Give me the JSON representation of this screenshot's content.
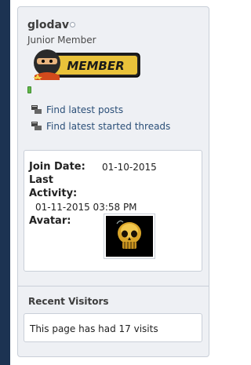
{
  "profile": {
    "username": "glodav",
    "user_title": "Junior Member",
    "rank_badge_text": "MEMBER",
    "online_status_icon": "offline-dot-icon",
    "reputation_color": "#61b74a"
  },
  "links": [
    {
      "label": "Find latest posts",
      "icon": "posts-icon"
    },
    {
      "label": "Find latest started threads",
      "icon": "threads-icon"
    }
  ],
  "stats": {
    "join_date_label": "Join Date:",
    "join_date_value": "01-10-2015",
    "last_activity_label": "Last Activity:",
    "last_activity_value": "01-11-2015 03:58 PM",
    "avatar_label": "Avatar:",
    "avatar_icon": "skull-avatar-icon"
  },
  "recent_visitors": {
    "title": "Recent Visitors",
    "text": "This page has had 17 visits"
  },
  "colors": {
    "sidebar": "#1c3352",
    "panel": "#eef0f4",
    "link": "#2b4f78"
  }
}
